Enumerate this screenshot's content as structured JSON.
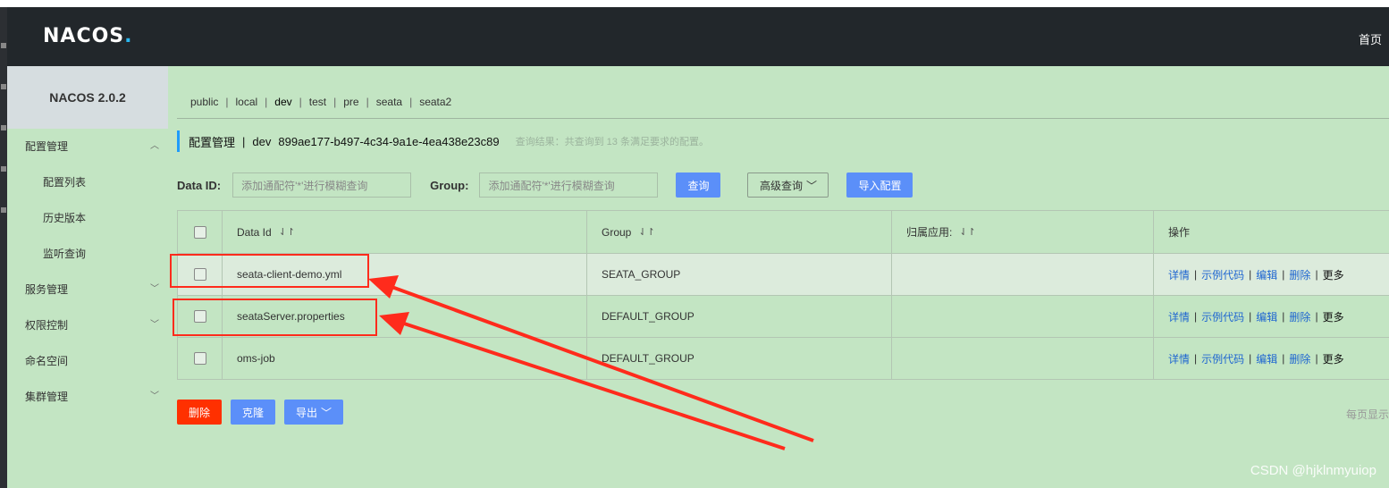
{
  "header": {
    "logo": "NACOS",
    "logo_dot": ".",
    "home": "首页"
  },
  "sidebar": {
    "version": "NACOS 2.0.2",
    "items": [
      {
        "label": "配置管理",
        "chevron": "chevron-up"
      },
      {
        "label": "配置列表",
        "sub": true
      },
      {
        "label": "历史版本",
        "sub": true
      },
      {
        "label": "监听查询",
        "sub": true
      },
      {
        "label": "服务管理",
        "chevron": "chevron-down"
      },
      {
        "label": "权限控制",
        "chevron": "chevron-down"
      },
      {
        "label": "命名空间"
      },
      {
        "label": "集群管理",
        "chevron": "chevron-down"
      }
    ]
  },
  "namespaces": [
    "public",
    "local",
    "dev",
    "test",
    "pre",
    "seata",
    "seata2"
  ],
  "namespace_active": "dev",
  "title": {
    "text": "配置管理",
    "sep": "|",
    "ns": "dev",
    "ns_id": "899ae177-b497-4c34-9a1e-4ea438e23c89",
    "hint": "查询结果：共查询到 13 条满足要求的配置。"
  },
  "filters": {
    "data_id_label": "Data ID:",
    "data_id_placeholder": "添加通配符'*'进行模糊查询",
    "group_label": "Group:",
    "group_placeholder": "添加通配符'*'进行模糊查询",
    "query_btn": "查询",
    "advanced_btn": "高级查询",
    "import_btn": "导入配置"
  },
  "table": {
    "headers": [
      "Data Id",
      "Group",
      "归属应用:",
      "操作"
    ],
    "sort_icon": "⇃↾",
    "rows": [
      {
        "data_id": "seata-client-demo.yml",
        "group": "SEATA_GROUP",
        "app": ""
      },
      {
        "data_id": "seataServer.properties",
        "group": "DEFAULT_GROUP",
        "app": ""
      },
      {
        "data_id": "oms-job",
        "group": "DEFAULT_GROUP",
        "app": ""
      }
    ],
    "actions": [
      "详情",
      "示例代码",
      "编辑",
      "删除",
      "更多"
    ],
    "action_sep": "|"
  },
  "bottom": {
    "delete_btn": "删除",
    "clone_btn": "克隆",
    "export_btn": "导出",
    "per_page": "每页显示"
  },
  "watermark": "CSDN @hjklnmyuiop",
  "colors": {
    "page_bg": "#c3e5c3",
    "header_bg": "#22272b",
    "primary": "#5b8ff9",
    "danger": "#ff3000",
    "link": "#1f66d1",
    "annotation": "#ff2b1c"
  }
}
